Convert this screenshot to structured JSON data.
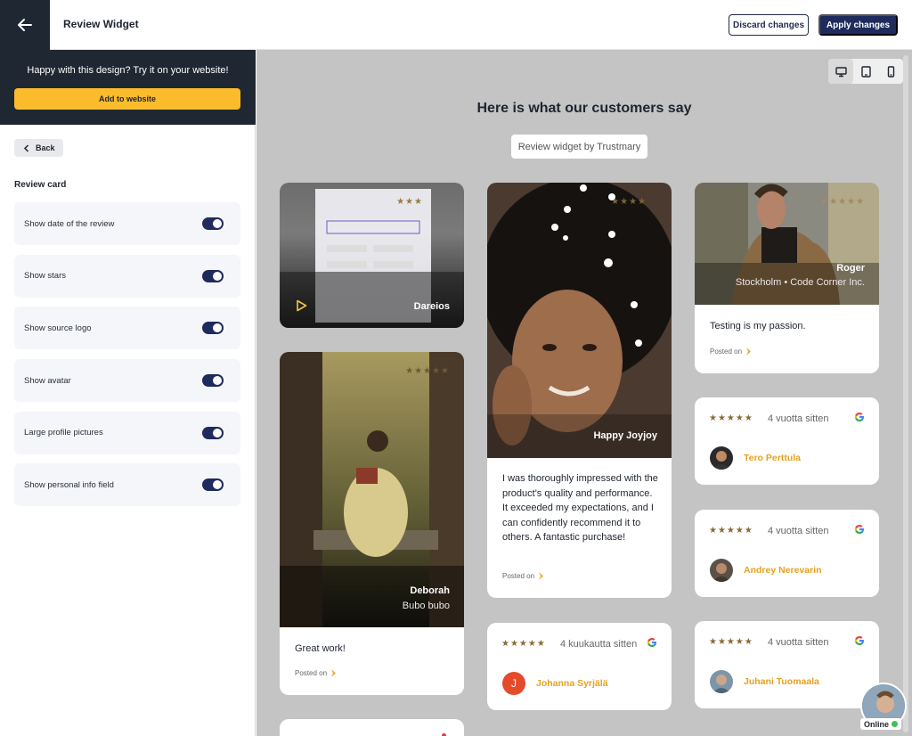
{
  "header": {
    "title": "Review Widget",
    "discard_label": "Discard changes",
    "apply_label": "Apply changes"
  },
  "sidebar": {
    "promo_text": "Happy with this design? Try it on your website!",
    "add_label": "Add to website",
    "back_label": "Back",
    "section_title": "Review card",
    "options": [
      {
        "label": "Show date of the review",
        "enabled": true
      },
      {
        "label": "Show stars",
        "enabled": true
      },
      {
        "label": "Show source logo",
        "enabled": true
      },
      {
        "label": "Show avatar",
        "enabled": true
      },
      {
        "label": "Large profile pictures",
        "enabled": true
      },
      {
        "label": "Show personal info field",
        "enabled": true
      }
    ]
  },
  "preview": {
    "heading": "Here is what our customers say",
    "badge": "Review widget by Trustmary",
    "devices": [
      "desktop-icon",
      "tablet-icon",
      "mobile-icon"
    ],
    "posted_label": "Posted on",
    "cards": {
      "dareios": {
        "name": "Dareios",
        "rating": 3
      },
      "deborah": {
        "name": "Deborah",
        "subtitle": "Bubo bubo",
        "text": "Great work!",
        "rating": 5
      },
      "joyjoy": {
        "name": "Happy Joyjoy",
        "text": "I was thoroughly impressed with the product's quality and performance. It exceeded my expectations, and I can confidently recommend it to others. A fantastic purchase!",
        "rating": 4
      },
      "johanna": {
        "name": "Johanna Syrjälä",
        "time": "4 kuukautta sitten",
        "rating": 5,
        "initial": "J"
      },
      "roger": {
        "name": "Roger",
        "subtitle": "Stockholm • Code Corner Inc.",
        "text": "Testing is my passion.",
        "rating": 5
      },
      "tero": {
        "name": "Tero Perttula",
        "time": "4 vuotta sitten",
        "rating": 5
      },
      "andrey": {
        "name": "Andrey Nerevarin",
        "time": "4 vuotta sitten",
        "rating": 5
      },
      "juhani": {
        "name": "Juhani Tuomaala",
        "time": "4 vuotta sitten",
        "rating": 5
      }
    },
    "stars_full": "★★★★★",
    "stars_three": "★★★",
    "stars_four": "★★★★"
  },
  "chat": {
    "status": "Online"
  },
  "colors": {
    "brand_dark": "#1f2733",
    "accent": "#fbbc2c",
    "primary": "#1f2b5c",
    "name_gold": "#e6a21e",
    "star": "#8b6a35"
  }
}
